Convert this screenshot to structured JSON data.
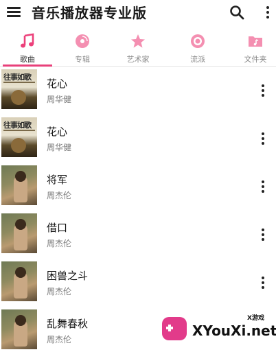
{
  "appbar": {
    "title": "音乐播放器专业版",
    "menu_icon": "hamburger-menu-icon",
    "search_icon": "search-icon",
    "more_icon": "more-vertical-icon"
  },
  "tabs": [
    {
      "label": "歌曲",
      "icon": "music-note-icon",
      "active": true
    },
    {
      "label": "专辑",
      "icon": "disc-icon",
      "active": false
    },
    {
      "label": "艺术家",
      "icon": "star-icon",
      "active": false
    },
    {
      "label": "流派",
      "icon": "genre-disc-icon",
      "active": false
    },
    {
      "label": "文件夹",
      "icon": "folder-music-icon",
      "active": false
    }
  ],
  "songs": [
    {
      "title": "花心",
      "artist": "周华健",
      "cover_text": "往事如歌"
    },
    {
      "title": "花心",
      "artist": "周华健",
      "cover_text": "往事如歌"
    },
    {
      "title": "将军",
      "artist": "周杰伦"
    },
    {
      "title": "借口",
      "artist": "周杰伦"
    },
    {
      "title": "困兽之斗",
      "artist": "周杰伦"
    },
    {
      "title": "乱舞春秋",
      "artist": "周杰伦"
    }
  ],
  "watermark": {
    "small_label": "X游戏",
    "brand": "XYouXi.net"
  },
  "colors": {
    "accent": "#e8407a",
    "tab_icon": "#f06292",
    "text_primary": "#111111",
    "text_secondary": "#777777"
  }
}
